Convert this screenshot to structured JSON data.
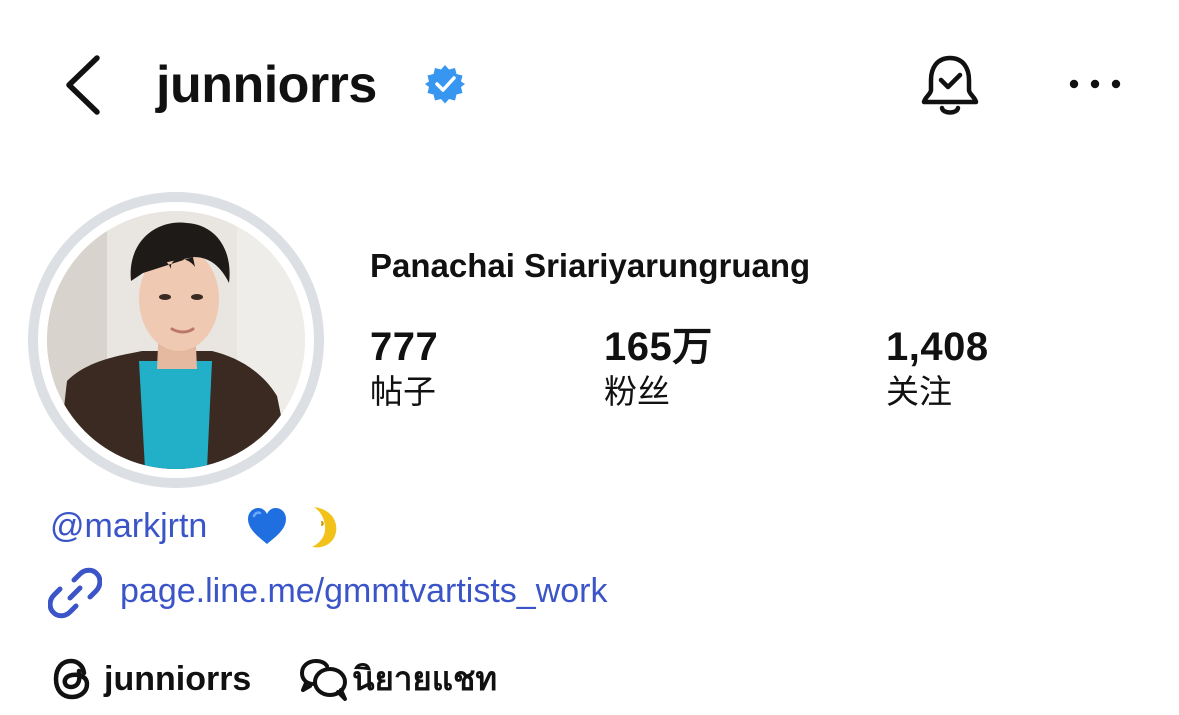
{
  "header": {
    "username": "junniorrs",
    "back_icon": "chevron-left-icon",
    "verified_icon": "verified-badge-icon",
    "bell_icon": "bell-check-icon",
    "more_icon": "more-horizontal-icon"
  },
  "profile": {
    "full_name": "Panachai Sriariyarungruang",
    "stats": [
      {
        "value": "777",
        "label": "帖子"
      },
      {
        "value": "165万",
        "label": "粉丝"
      },
      {
        "value": "1,408",
        "label": "关注"
      }
    ]
  },
  "bio": {
    "mention": "@markjrtn",
    "emojis": [
      "blue-heart-emoji",
      "crescent-moon-emoji"
    ],
    "link_icon": "link-icon",
    "link": "page.line.me/gmmtvartists_work"
  },
  "bottom": {
    "threads_icon": "threads-icon",
    "threads_name": "junniorrs",
    "chat_icon": "chat-bubbles-icon",
    "chat_label": "นิยายแชท"
  },
  "colors": {
    "link_blue": "#3b55c8",
    "verified_blue": "#3797f0",
    "text": "#111111",
    "ring": "#dcdfe3"
  }
}
